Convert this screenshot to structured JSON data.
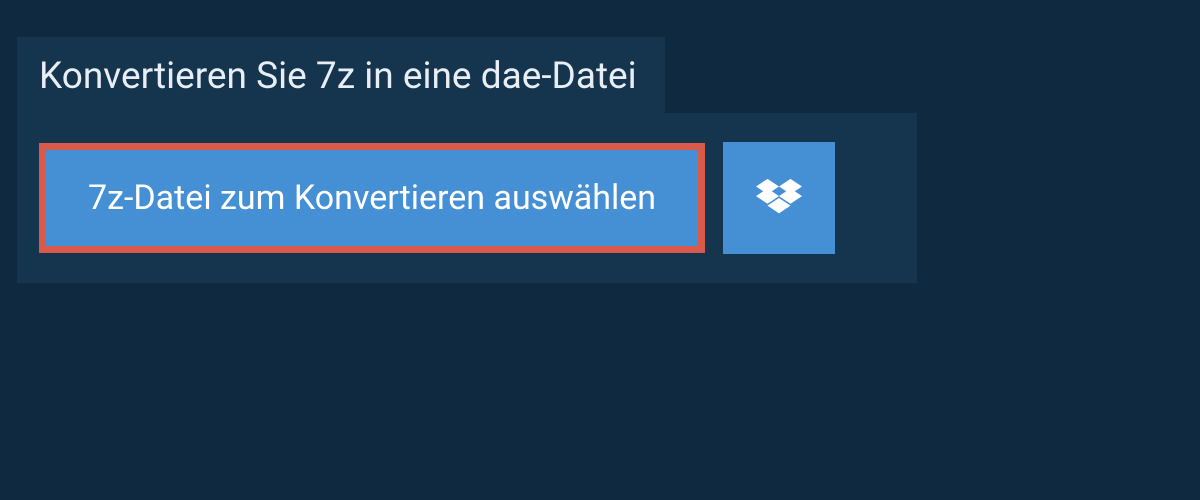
{
  "header": {
    "title": "Konvertieren Sie 7z in eine dae-Datei"
  },
  "upload": {
    "select_button_label": "7z-Datei zum Konvertieren auswählen",
    "dropbox_icon": "dropbox"
  },
  "colors": {
    "page_bg": "#0f2940",
    "panel_bg": "#15354f",
    "button_bg": "#4590d5",
    "highlight_border": "#d9594b",
    "text_light": "#e8eef4",
    "text_white": "#ffffff"
  }
}
